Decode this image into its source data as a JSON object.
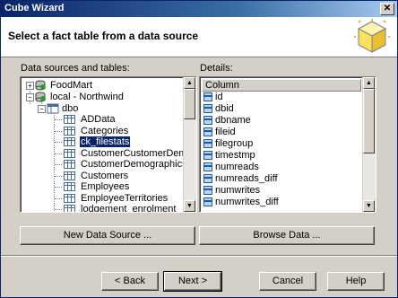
{
  "window": {
    "title": "Cube Wizard"
  },
  "header": {
    "heading": "Select a fact table from a data source"
  },
  "tree": {
    "label": "Data sources and tables:",
    "items": [
      {
        "label": "FoodMart"
      },
      {
        "label": "local - Northwind"
      },
      {
        "label": "dbo"
      },
      {
        "label": "ADData"
      },
      {
        "label": "Categories"
      },
      {
        "label": "ck_filestats"
      },
      {
        "label": "CustomerCustomerDemo"
      },
      {
        "label": "CustomerDemographics"
      },
      {
        "label": "Customers"
      },
      {
        "label": "Employees"
      },
      {
        "label": "EmployeeTerritories"
      },
      {
        "label": "lodgement_enrolment"
      }
    ]
  },
  "details": {
    "label": "Details:",
    "column_header": "Column",
    "columns": [
      "id",
      "dbid",
      "dbname",
      "fileid",
      "filegroup",
      "timestmp",
      "numreads",
      "numreads_diff",
      "numwrites",
      "numwrites_diff"
    ]
  },
  "buttons": {
    "new_data_source": "New Data Source ...",
    "browse_data": "Browse Data ...",
    "back": "< Back",
    "next": "Next >",
    "cancel": "Cancel",
    "help": "Help"
  }
}
